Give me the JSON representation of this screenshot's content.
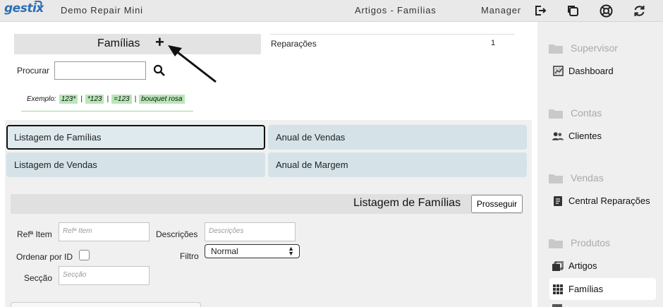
{
  "topbar": {
    "logo": "gestix",
    "app_name": "Demo Repair Mini",
    "page_title": "Artigos - Famílias",
    "user": "Manager",
    "icons": [
      "logout-icon",
      "copy-icon",
      "help-lifebuoy-icon",
      "refresh-icon"
    ]
  },
  "search": {
    "title": "Famílias",
    "add_label": "+",
    "procurar_label": "Procurar",
    "procurar_value": "",
    "exemplo_label": "Exemplo:",
    "examples": [
      "123*",
      "*123",
      "=123",
      "bouquet rosa"
    ],
    "separator": "|"
  },
  "reparacoes": {
    "label": "Reparações",
    "count": "1"
  },
  "reports": {
    "buttons": [
      {
        "label": "Listagem de Famílias",
        "selected": true
      },
      {
        "label": "Anual de Vendas",
        "selected": false
      },
      {
        "label": "Listagem de Vendas",
        "selected": false
      },
      {
        "label": "Anual de Margem",
        "selected": false
      }
    ]
  },
  "form": {
    "title": "Listagem de Famílias",
    "proceed_label": "Prosseguir",
    "ref_item_label": "Refª Item",
    "ref_item_placeholder": "Refª Item",
    "descricoes_label": "Descrições",
    "descricoes_placeholder": "Descrições",
    "ordenar_label": "Ordenar por ID",
    "filtro_label": "Filtro",
    "filtro_value": "Normal",
    "seccao_label": "Secção",
    "seccao_placeholder": "Secção"
  },
  "sidebar": {
    "sections": [
      {
        "label": "Supervisor",
        "items": [
          {
            "label": "Dashboard",
            "icon": "chart-icon"
          }
        ]
      },
      {
        "label": "Contas",
        "items": [
          {
            "label": "Clientes",
            "icon": "users-icon"
          }
        ]
      },
      {
        "label": "Vendas",
        "items": [
          {
            "label": "Central Reparações",
            "icon": "document-icon"
          }
        ]
      },
      {
        "label": "Produtos",
        "items": [
          {
            "label": "Artigos",
            "icon": "boxes-icon"
          },
          {
            "label": "Famílias",
            "icon": "grid-icon",
            "active": true
          }
        ]
      }
    ]
  },
  "colors": {
    "accent": "#2d6fb3",
    "chip": "#b8e7b8",
    "report_button": "#d5e3e8"
  }
}
